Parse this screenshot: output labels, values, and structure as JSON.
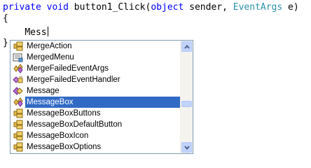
{
  "editor": {
    "line1": {
      "kw1": "private",
      "kw2": "void",
      "method": "button1_Click(",
      "kw3": "object",
      "p1": "sender,",
      "type": "EventArgs",
      "p2": "e)"
    },
    "line2": "{",
    "line3_indent": "    ",
    "line3_text": "Mess",
    "line4": "}"
  },
  "intellisense": {
    "items": [
      {
        "label": "MergeAction",
        "icon": "enum-icon"
      },
      {
        "label": "MergedMenu",
        "icon": "property-icon"
      },
      {
        "label": "MergeFailedEventArgs",
        "icon": "class-icon"
      },
      {
        "label": "MergeFailedEventHandler",
        "icon": "delegate-icon"
      },
      {
        "label": "Message",
        "icon": "struct-icon"
      },
      {
        "label": "MessageBox",
        "icon": "class-icon",
        "selected": true
      },
      {
        "label": "MessageBoxButtons",
        "icon": "enum-icon"
      },
      {
        "label": "MessageBoxDefaultButton",
        "icon": "enum-icon"
      },
      {
        "label": "MessageBoxIcon",
        "icon": "enum-icon"
      },
      {
        "label": "MessageBoxOptions",
        "icon": "enum-icon"
      }
    ]
  },
  "colors": {
    "keyword": "#0000ff",
    "type": "#2b91af",
    "selection": "#316ac5"
  }
}
